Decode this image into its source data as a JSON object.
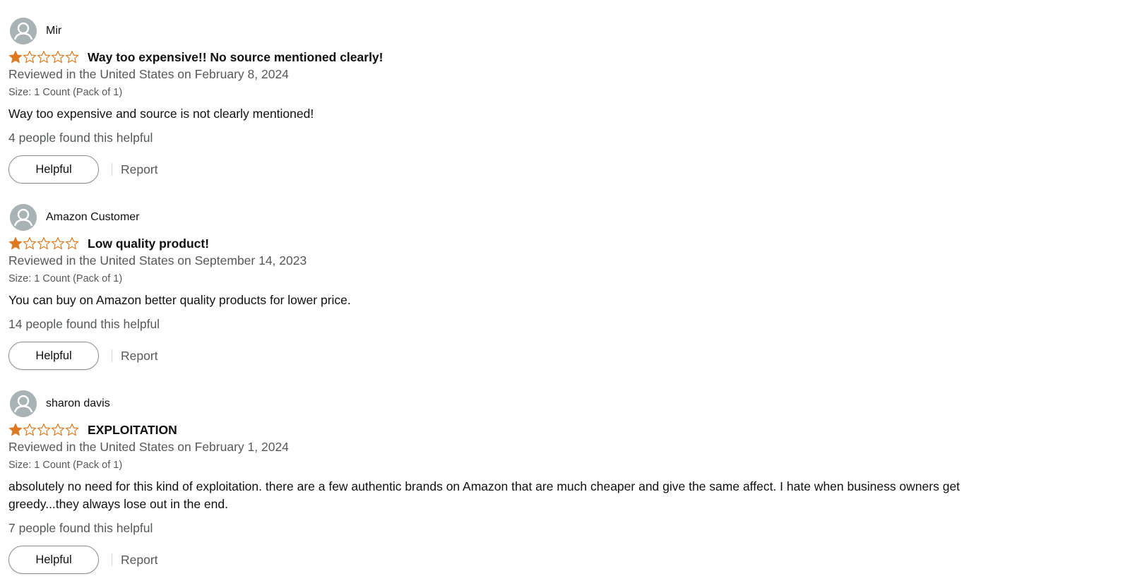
{
  "colors": {
    "star_fill": "#de7921",
    "star_outline": "#de7921",
    "secondary_text": "#565959",
    "primary_text": "#0f1111",
    "avatar_bg": "#a9b2b4"
  },
  "reviews": [
    {
      "profile_name": "Mir",
      "rating": 1,
      "rating_max": 5,
      "title": "Way too expensive!! No source mentioned clearly!",
      "date": "Reviewed in the United States on February 8, 2024",
      "size": "Size: 1 Count (Pack of 1)",
      "body": "Way too expensive and source is not clearly mentioned!",
      "helpful_count": "4 people found this helpful",
      "helpful_label": "Helpful",
      "report_label": "Report",
      "avatar_icon": "user-avatar-icon"
    },
    {
      "profile_name": "Amazon Customer",
      "rating": 1,
      "rating_max": 5,
      "title": "Low quality product!",
      "date": "Reviewed in the United States on September 14, 2023",
      "size": "Size: 1 Count (Pack of 1)",
      "body": "You can buy on Amazon better quality products for lower price.",
      "helpful_count": "14 people found this helpful",
      "helpful_label": "Helpful",
      "report_label": "Report",
      "avatar_icon": "user-avatar-icon"
    },
    {
      "profile_name": "sharon davis",
      "rating": 1,
      "rating_max": 5,
      "title": "EXPLOITATION",
      "date": "Reviewed in the United States on February 1, 2024",
      "size": "Size: 1 Count (Pack of 1)",
      "body": "absolutely no need for this kind of exploitation. there are a few authentic brands on Amazon that are much cheaper and give the same affect. I hate when business owners get greedy...they always lose out in the end.",
      "helpful_count": "7 people found this helpful",
      "helpful_label": "Helpful",
      "report_label": "Report",
      "avatar_icon": "user-avatar-icon"
    }
  ]
}
